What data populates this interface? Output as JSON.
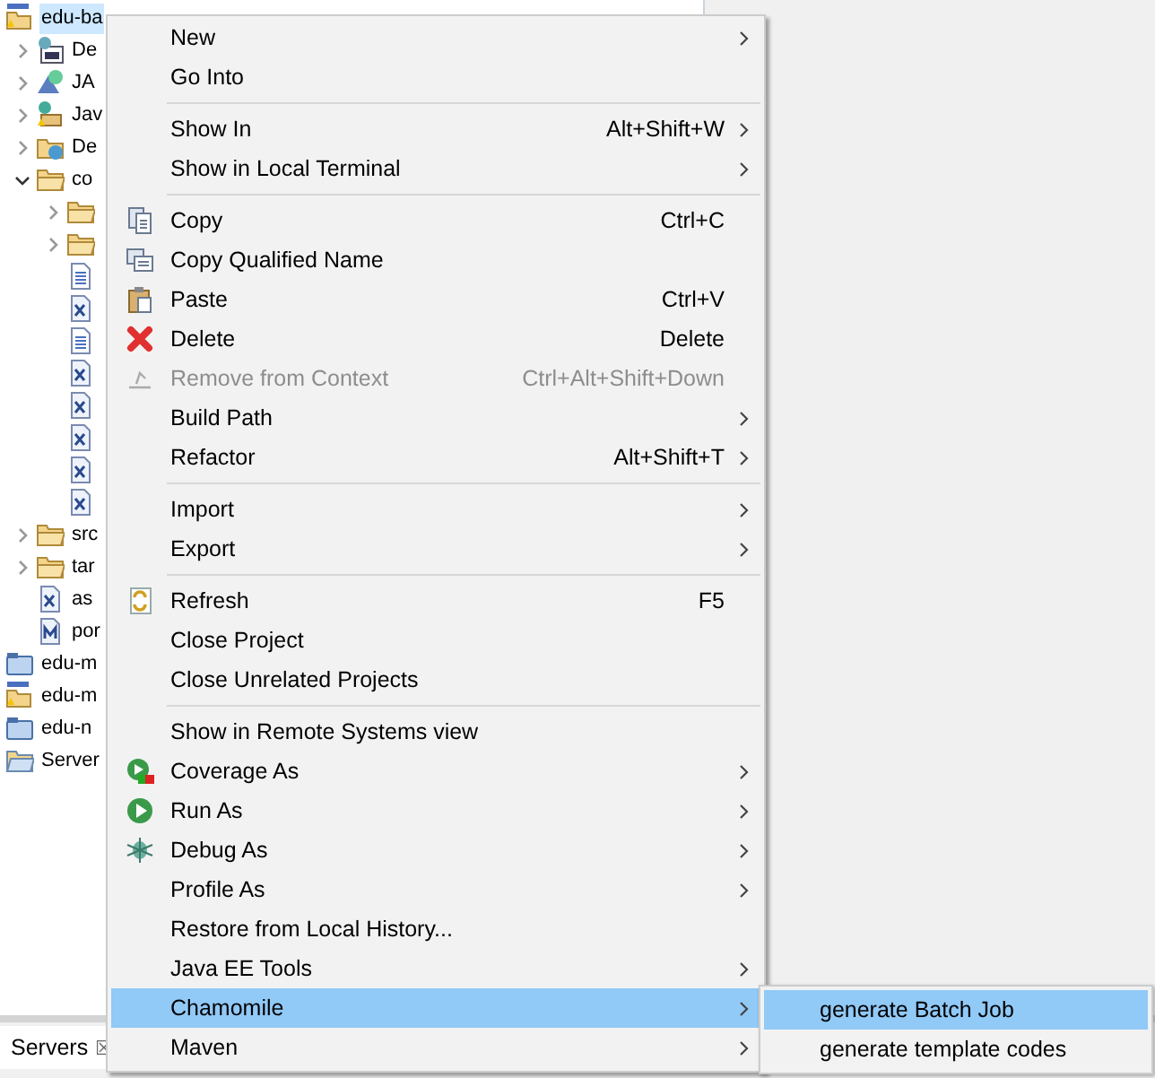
{
  "tree": [
    {
      "label": "edu-ba",
      "kind": "maven-project",
      "selected": true,
      "children": [
        {
          "label": "De",
          "kind": "library",
          "expanded": false,
          "selected": false
        },
        {
          "label": "JA",
          "kind": "webservice",
          "expanded": false,
          "selected": false
        },
        {
          "label": "Jav",
          "kind": "java-resources",
          "expanded": false,
          "selected": false
        },
        {
          "label": "De",
          "kind": "deployed",
          "expanded": false,
          "selected": false
        },
        {
          "label": "co",
          "kind": "folder",
          "expanded": true,
          "selected": false,
          "children": [
            {
              "kind": "folder",
              "expanded": false
            },
            {
              "kind": "folder",
              "expanded": false
            },
            {
              "kind": "text-file"
            },
            {
              "kind": "xml-file"
            },
            {
              "kind": "text-file"
            },
            {
              "kind": "xml-file"
            },
            {
              "kind": "xml-file"
            },
            {
              "kind": "xml-file"
            },
            {
              "kind": "xml-file"
            },
            {
              "kind": "xml-file"
            }
          ]
        },
        {
          "label": "src",
          "kind": "folder",
          "expanded": false,
          "selected": false
        },
        {
          "label": "tar",
          "kind": "folder",
          "expanded": false,
          "selected": false
        },
        {
          "label": "as",
          "kind": "xml-file",
          "selected": false
        },
        {
          "label": "por",
          "kind": "pom-file",
          "selected": false
        }
      ]
    },
    {
      "label": "edu-m",
      "kind": "project",
      "selected": false
    },
    {
      "label": "edu-m",
      "kind": "maven-project",
      "selected": false
    },
    {
      "label": "edu-n",
      "kind": "project",
      "selected": false
    },
    {
      "label": "Server",
      "kind": "open-folder",
      "selected": false
    }
  ],
  "bottom_tab": {
    "label": "Servers",
    "close": "☒"
  },
  "context_menu": [
    {
      "kind": "item",
      "label": "New",
      "submenu": true,
      "disabled": false,
      "selected": false
    },
    {
      "kind": "item",
      "label": "Go Into",
      "submenu": false,
      "disabled": false,
      "selected": false
    },
    {
      "kind": "separator"
    },
    {
      "kind": "item",
      "label": "Show In",
      "shortcut": "Alt+Shift+W",
      "submenu": true,
      "disabled": false,
      "selected": false
    },
    {
      "kind": "item",
      "label": "Show in Local Terminal",
      "submenu": true,
      "disabled": false,
      "selected": false
    },
    {
      "kind": "separator"
    },
    {
      "kind": "item",
      "label": "Copy",
      "shortcut": "Ctrl+C",
      "submenu": false,
      "disabled": false,
      "selected": false
    },
    {
      "kind": "item",
      "label": "Copy Qualified Name",
      "submenu": false,
      "disabled": false,
      "selected": false
    },
    {
      "kind": "item",
      "label": "Paste",
      "shortcut": "Ctrl+V",
      "submenu": false,
      "disabled": false,
      "selected": false
    },
    {
      "kind": "item",
      "label": "Delete",
      "shortcut": "Delete",
      "submenu": false,
      "disabled": false,
      "selected": false
    },
    {
      "kind": "item",
      "label": "Remove from Context",
      "shortcut": "Ctrl+Alt+Shift+Down",
      "submenu": false,
      "disabled": true,
      "selected": false
    },
    {
      "kind": "item",
      "label": "Build Path",
      "submenu": true,
      "disabled": false,
      "selected": false
    },
    {
      "kind": "item",
      "label": "Refactor",
      "shortcut": "Alt+Shift+T",
      "submenu": true,
      "disabled": false,
      "selected": false
    },
    {
      "kind": "separator"
    },
    {
      "kind": "item",
      "label": "Import",
      "submenu": true,
      "disabled": false,
      "selected": false
    },
    {
      "kind": "item",
      "label": "Export",
      "submenu": true,
      "disabled": false,
      "selected": false
    },
    {
      "kind": "separator"
    },
    {
      "kind": "item",
      "label": "Refresh",
      "shortcut": "F5",
      "submenu": false,
      "disabled": false,
      "selected": false
    },
    {
      "kind": "item",
      "label": "Close Project",
      "submenu": false,
      "disabled": false,
      "selected": false
    },
    {
      "kind": "item",
      "label": "Close Unrelated Projects",
      "submenu": false,
      "disabled": false,
      "selected": false
    },
    {
      "kind": "separator"
    },
    {
      "kind": "item",
      "label": "Show in Remote Systems view",
      "submenu": false,
      "disabled": false,
      "selected": false
    },
    {
      "kind": "item",
      "label": "Coverage As",
      "submenu": true,
      "disabled": false,
      "selected": false
    },
    {
      "kind": "item",
      "label": "Run As",
      "submenu": true,
      "disabled": false,
      "selected": false
    },
    {
      "kind": "item",
      "label": "Debug As",
      "submenu": true,
      "disabled": false,
      "selected": false
    },
    {
      "kind": "item",
      "label": "Profile As",
      "submenu": true,
      "disabled": false,
      "selected": false
    },
    {
      "kind": "item",
      "label": "Restore from Local History...",
      "submenu": false,
      "disabled": false,
      "selected": false
    },
    {
      "kind": "item",
      "label": "Java EE Tools",
      "submenu": true,
      "disabled": false,
      "selected": false
    },
    {
      "kind": "item",
      "label": "Chamomile",
      "submenu": true,
      "disabled": false,
      "selected": true
    },
    {
      "kind": "item",
      "label": "Maven",
      "submenu": true,
      "disabled": false,
      "selected": false
    }
  ],
  "submenu": [
    {
      "label": "generate Batch Job",
      "selected": true
    },
    {
      "label": "generate template codes",
      "selected": false
    }
  ]
}
